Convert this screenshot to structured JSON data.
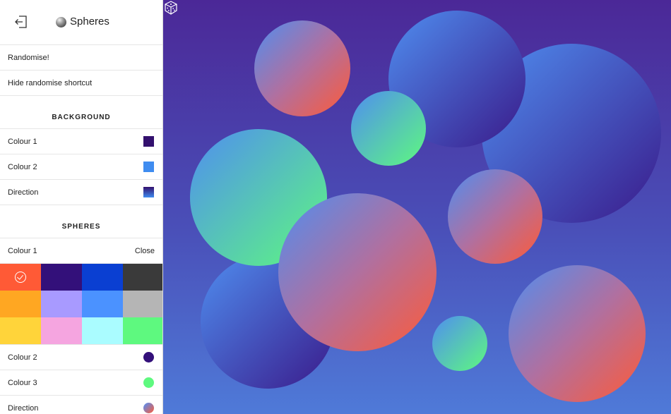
{
  "app": {
    "title": "Spheres",
    "back_icon": "exit-icon",
    "app_icon": "sphere-icon"
  },
  "actions": {
    "randomise": "Randomise!",
    "hide_shortcut": "Hide randomise shortcut"
  },
  "background": {
    "heading": "BACKGROUND",
    "colour1": {
      "label": "Colour 1",
      "color": "#33106e"
    },
    "colour2": {
      "label": "Colour 2",
      "color": "#3f8cf0"
    },
    "direction": {
      "label": "Direction"
    }
  },
  "spheres": {
    "heading": "SPHERES",
    "colour1": {
      "label": "Colour 1",
      "close": "Close"
    },
    "palette": [
      {
        "color": "#ff5a36",
        "selected": true
      },
      {
        "color": "#33107a"
      },
      {
        "color": "#0a3fd2"
      },
      {
        "color": "#3a3a3a"
      },
      {
        "color": "#ffa722"
      },
      {
        "color": "#a89aff"
      },
      {
        "color": "#4b92ff"
      },
      {
        "color": "#b5b5b5"
      },
      {
        "color": "#ffd43a"
      },
      {
        "color": "#f5a5e0"
      },
      {
        "color": "#aafcff"
      },
      {
        "color": "#5ef97f"
      }
    ],
    "colour2": {
      "label": "Colour 2",
      "color": "#33107a"
    },
    "colour3": {
      "label": "Colour 3",
      "color": "#5ef97f"
    },
    "direction": {
      "label": "Direction"
    }
  },
  "canvas": {
    "shortcut_icon": "dice-icon"
  }
}
